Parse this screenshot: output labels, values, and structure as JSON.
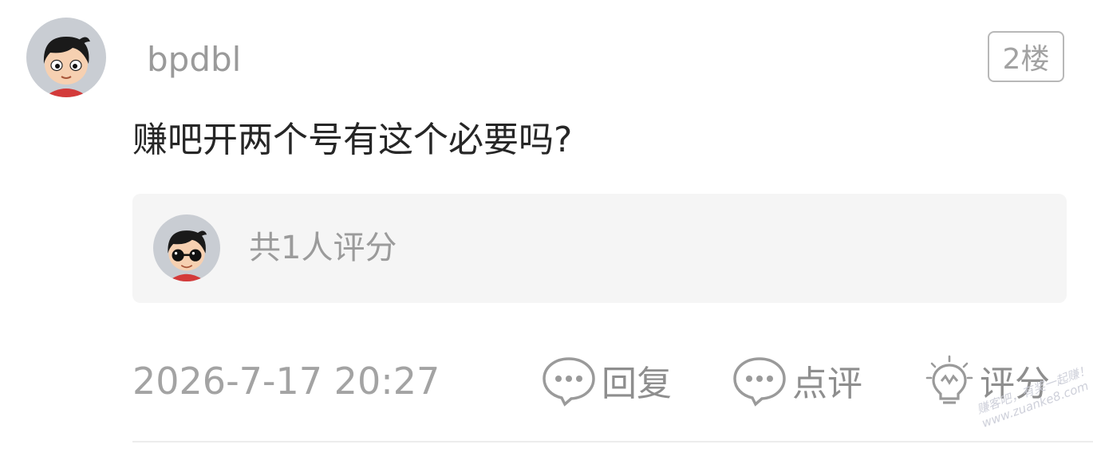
{
  "post": {
    "username": "bpdbl",
    "floor": "2楼",
    "content": "赚吧开两个号有这个必要吗?",
    "time": "2026-7-17 20:27"
  },
  "rating": {
    "summary": "共1人评分"
  },
  "actions": {
    "reply": {
      "label": "回复",
      "icon": "speech-bubble-icon"
    },
    "review": {
      "label": "点评",
      "icon": "speech-bubble-icon"
    },
    "rate": {
      "label": "评分",
      "icon": "lightbulb-icon"
    }
  },
  "watermark": {
    "line1": "赚客吧，有奖一起赚！",
    "line2": "www.zuanke8.com"
  },
  "colors": {
    "username": "#9a9a9a",
    "content": "#262626",
    "meta": "#a3a3a3",
    "rating_bg": "#f5f5f5"
  }
}
